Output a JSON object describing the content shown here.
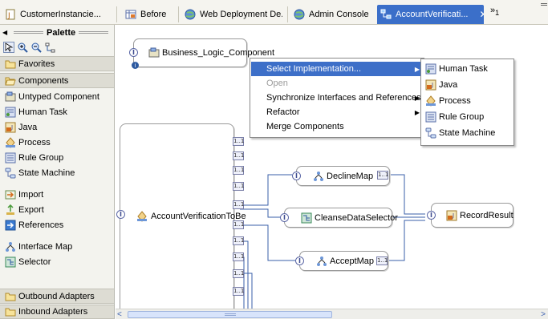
{
  "tabs": [
    {
      "label": "CustomerInstancie...",
      "icon": "java-file-icon",
      "active": false
    },
    {
      "label": "Before",
      "icon": "table-icon",
      "active": false
    },
    {
      "label": "Web Deployment De...",
      "icon": "globe-icon",
      "active": false
    },
    {
      "label": "Admin Console",
      "icon": "globe-icon",
      "active": false
    },
    {
      "label": "AccountVerificati...",
      "icon": "assembly-diagram-icon",
      "active": true
    }
  ],
  "tab_overflow": {
    "symbol": "»",
    "count": "1"
  },
  "palette": {
    "title": "Palette",
    "drawers": {
      "favorites": "Favorites",
      "components": "Components",
      "outbound": "Outbound Adapters",
      "inbound": "Inbound Adapters"
    },
    "components": [
      {
        "label": "Untyped Component",
        "icon": "untyped-component-icon"
      },
      {
        "label": "Human Task",
        "icon": "human-task-icon"
      },
      {
        "label": "Java",
        "icon": "java-icon"
      },
      {
        "label": "Process",
        "icon": "process-icon"
      },
      {
        "label": "Rule Group",
        "icon": "rule-group-icon"
      },
      {
        "label": "State Machine",
        "icon": "state-machine-icon"
      }
    ],
    "others": [
      {
        "label": "Import",
        "icon": "import-icon"
      },
      {
        "label": "Export",
        "icon": "export-icon"
      },
      {
        "label": "References",
        "icon": "references-icon"
      }
    ],
    "wiring": [
      {
        "label": "Interface Map",
        "icon": "interface-map-icon"
      },
      {
        "label": "Selector",
        "icon": "selector-icon"
      }
    ]
  },
  "canvas": {
    "components": {
      "business_logic": "Business_Logic_Component",
      "account_verification": "AccountVerificationToBe",
      "decline_map": "DeclineMap",
      "cleanse_selector": "CleanseDataSelector",
      "accept_map": "AcceptMap",
      "record_result": "RecordResult"
    },
    "interface_glyph": "I",
    "ref_label": "1..1"
  },
  "context_menu": {
    "items": [
      {
        "label": "Select Implementation...",
        "highlighted": true,
        "submenu": true,
        "disabled": false
      },
      {
        "label": "Open",
        "highlighted": false,
        "submenu": false,
        "disabled": true
      },
      {
        "label": "Synchronize Interfaces and References...",
        "highlighted": false,
        "submenu": true,
        "disabled": false
      },
      {
        "label": "Refactor",
        "highlighted": false,
        "submenu": true,
        "disabled": false
      },
      {
        "label": "Merge Components",
        "highlighted": false,
        "submenu": false,
        "disabled": false
      }
    ],
    "submenu": [
      {
        "label": "Human Task",
        "icon": "human-task-icon"
      },
      {
        "label": "Java",
        "icon": "java-icon"
      },
      {
        "label": "Process",
        "icon": "process-icon"
      },
      {
        "label": "Rule Group",
        "icon": "rule-group-icon"
      },
      {
        "label": "State Machine",
        "icon": "state-machine-icon"
      }
    ]
  },
  "colors": {
    "active_tab": "#3b6fc9",
    "menu_highlight": "#3d6fc8",
    "palette_bg": "#f3f3ee",
    "drawer_bg": "#dddcd3"
  }
}
